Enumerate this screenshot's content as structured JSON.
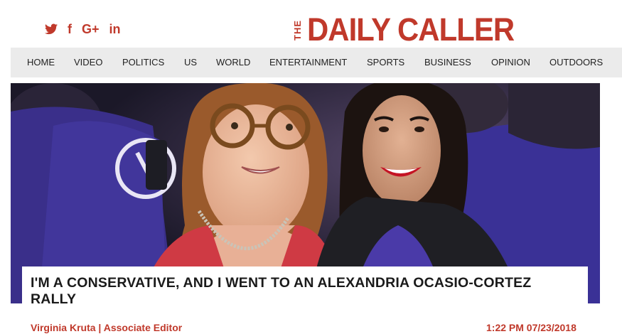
{
  "social": [
    {
      "icon": "twitter-icon"
    },
    {
      "icon": "facebook-icon",
      "glyph": "f"
    },
    {
      "icon": "google-plus-icon",
      "glyph": "G+"
    },
    {
      "icon": "linkedin-icon",
      "glyph": "in"
    }
  ],
  "logo": {
    "the": "THE",
    "name": "DAILY CALLER"
  },
  "nav": [
    "HOME",
    "VIDEO",
    "POLITICS",
    "US",
    "WORLD",
    "ENTERTAINMENT",
    "SPORTS",
    "BUSINESS",
    "OPINION",
    "OUTDOORS"
  ],
  "article": {
    "headline": "I'M A CONSERVATIVE, AND I WENT TO AN ALEXANDRIA OCASIO-CORTEZ RALLY",
    "byline": "Virginia Kruta | Associate Editor",
    "timestamp": "1:22 PM 07/23/2018"
  },
  "colors": {
    "brand": "#c0392b",
    "nav_bg": "#ebebeb",
    "text": "#1a1a1a"
  }
}
